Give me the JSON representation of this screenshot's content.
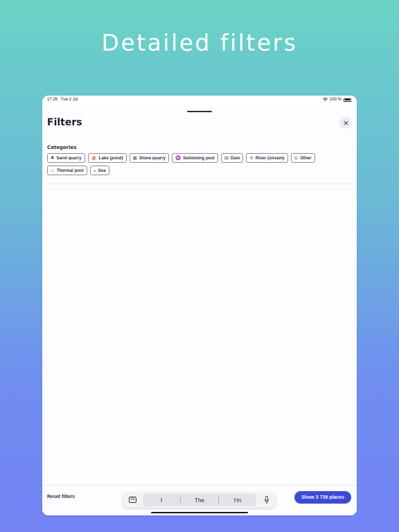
{
  "headline": "Detailed filters",
  "status_bar": {
    "time": "17:26",
    "date": "Tue 2 Jul",
    "battery": "100 %"
  },
  "sheet": {
    "title": "Filters",
    "section_label": "Categories",
    "categories": [
      {
        "label": "Sand quarry",
        "icon": "sand-icon"
      },
      {
        "label": "Lake (pond)",
        "icon": "boat-icon"
      },
      {
        "label": "Stone quarry",
        "icon": "stone-icon"
      },
      {
        "label": "Swimming pool",
        "icon": "pool-icon"
      },
      {
        "label": "Dam",
        "icon": "dam-icon"
      },
      {
        "label": "River (stream)",
        "icon": "river-icon"
      },
      {
        "label": "Other",
        "icon": "other-icon"
      },
      {
        "label": "Thermal pool",
        "icon": "thermal-icon"
      },
      {
        "label": "Sea",
        "icon": "sea-icon"
      }
    ]
  },
  "footer": {
    "reset_label": "Reset filters",
    "show_label": "Show 3 739 places"
  },
  "keyboard": {
    "lang": "EN",
    "suggestions": [
      "I",
      "The",
      "I'm"
    ]
  },
  "colors": {
    "accent": "#3d4bd3",
    "background_top": "#6ad3c6",
    "background_bottom": "#7383f4"
  }
}
